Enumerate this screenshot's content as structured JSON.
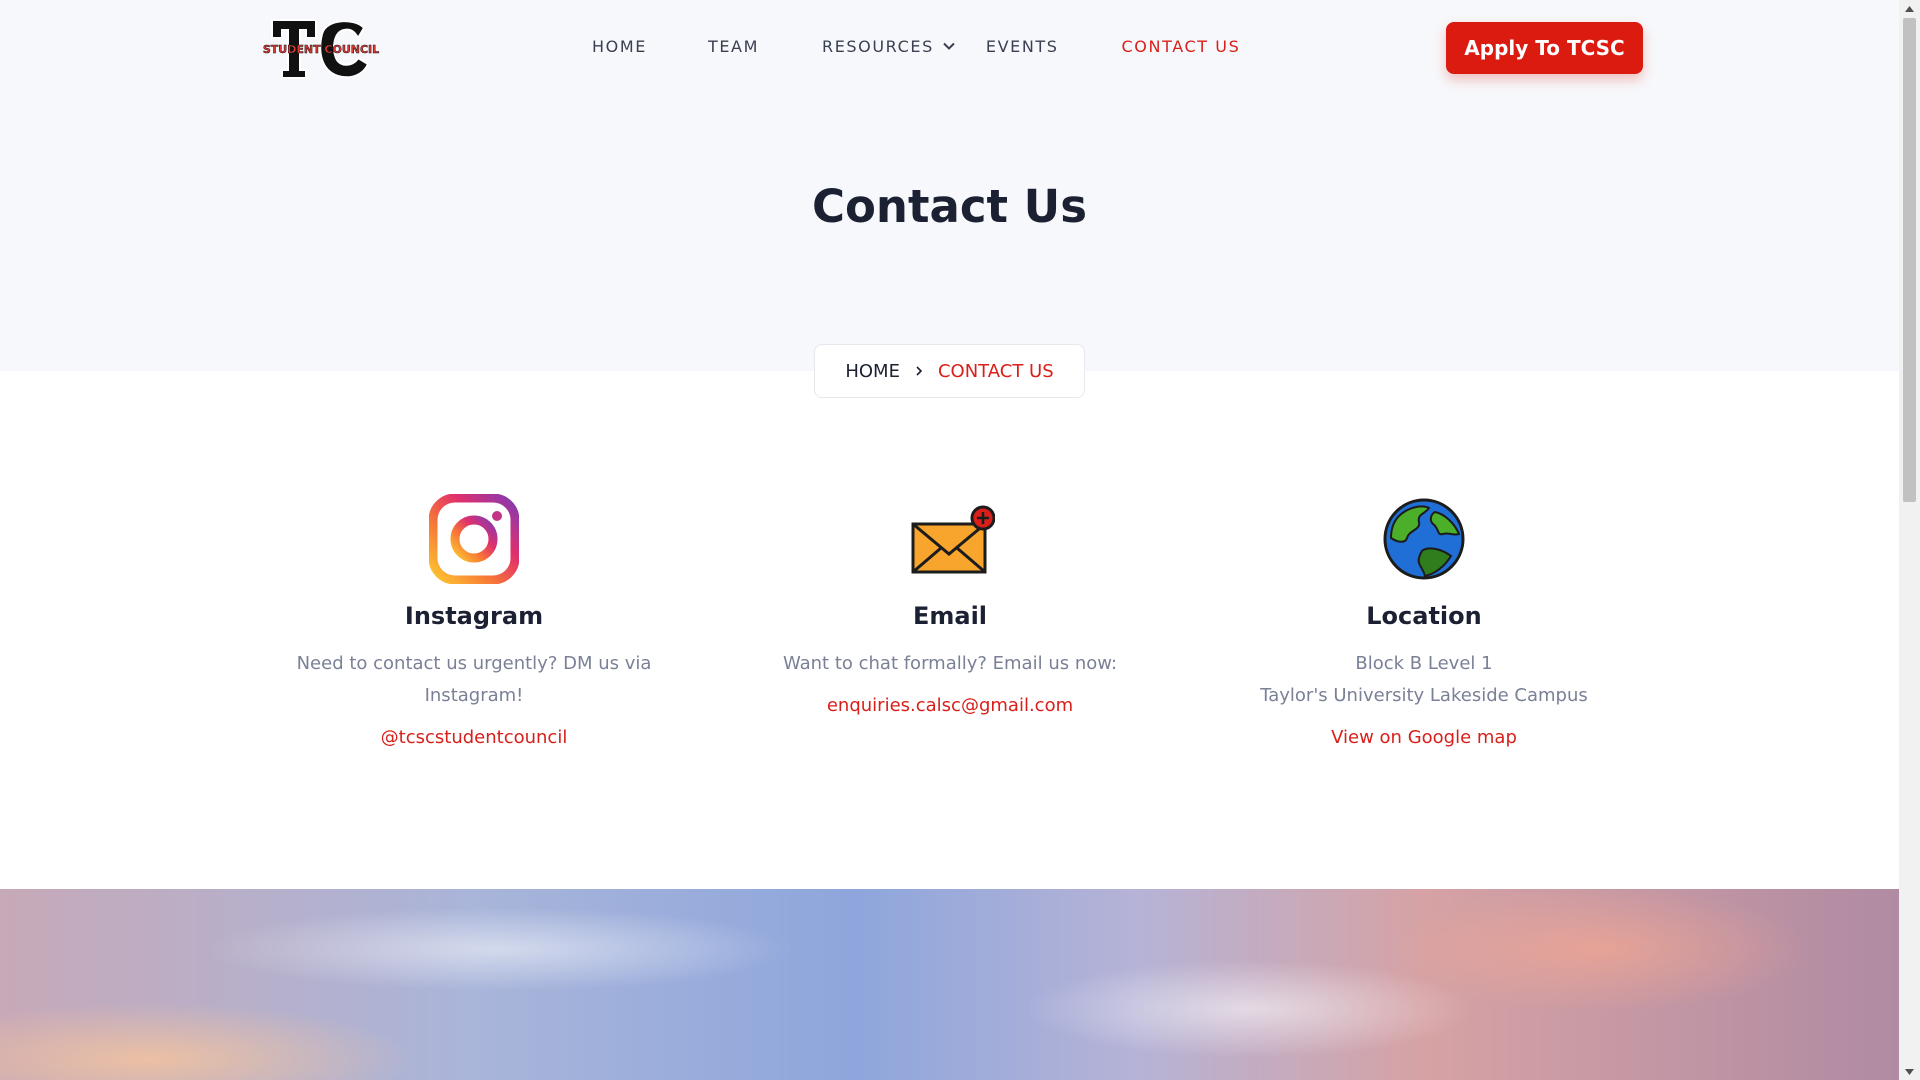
{
  "brand": {
    "logo_icon": "tc-student-council-logo",
    "logo_letters": "TC",
    "logo_text": "STUDENT COUNCIL"
  },
  "nav": {
    "items": [
      {
        "label": "HOME"
      },
      {
        "label": "TEAM"
      },
      {
        "label": "RESOURCES",
        "icon": "chevron-down-icon"
      },
      {
        "label": "EVENTS"
      },
      {
        "label": "CONTACT US",
        "active": true
      }
    ],
    "cta_label": "Apply To TCSC"
  },
  "page": {
    "title": "Contact Us"
  },
  "breadcrumb": {
    "home": "HOME",
    "separator_icon": "chevron-right-icon",
    "current": "CONTACT US"
  },
  "contacts": {
    "instagram": {
      "icon": "instagram-icon",
      "title": "Instagram",
      "desc_line1": "Need to contact us urgently? DM us via",
      "desc_line2": "Instagram!",
      "link": "@tcscstudentcouncil"
    },
    "email": {
      "icon": "email-icon",
      "title": "Email",
      "desc_line1": "Want to chat formally? Email us now:",
      "link": "enquiries.calsc@gmail.com"
    },
    "location": {
      "icon": "globe-icon",
      "title": "Location",
      "desc_line1": "Block B Level 1",
      "desc_line2": "Taylor's University Lakeside Campus",
      "link": "View on Google map"
    }
  },
  "colors": {
    "accent": "#dc1b10",
    "text_dark": "#1c2033",
    "text_muted": "#7a8196",
    "hero_bg": "#f7f8fb"
  }
}
